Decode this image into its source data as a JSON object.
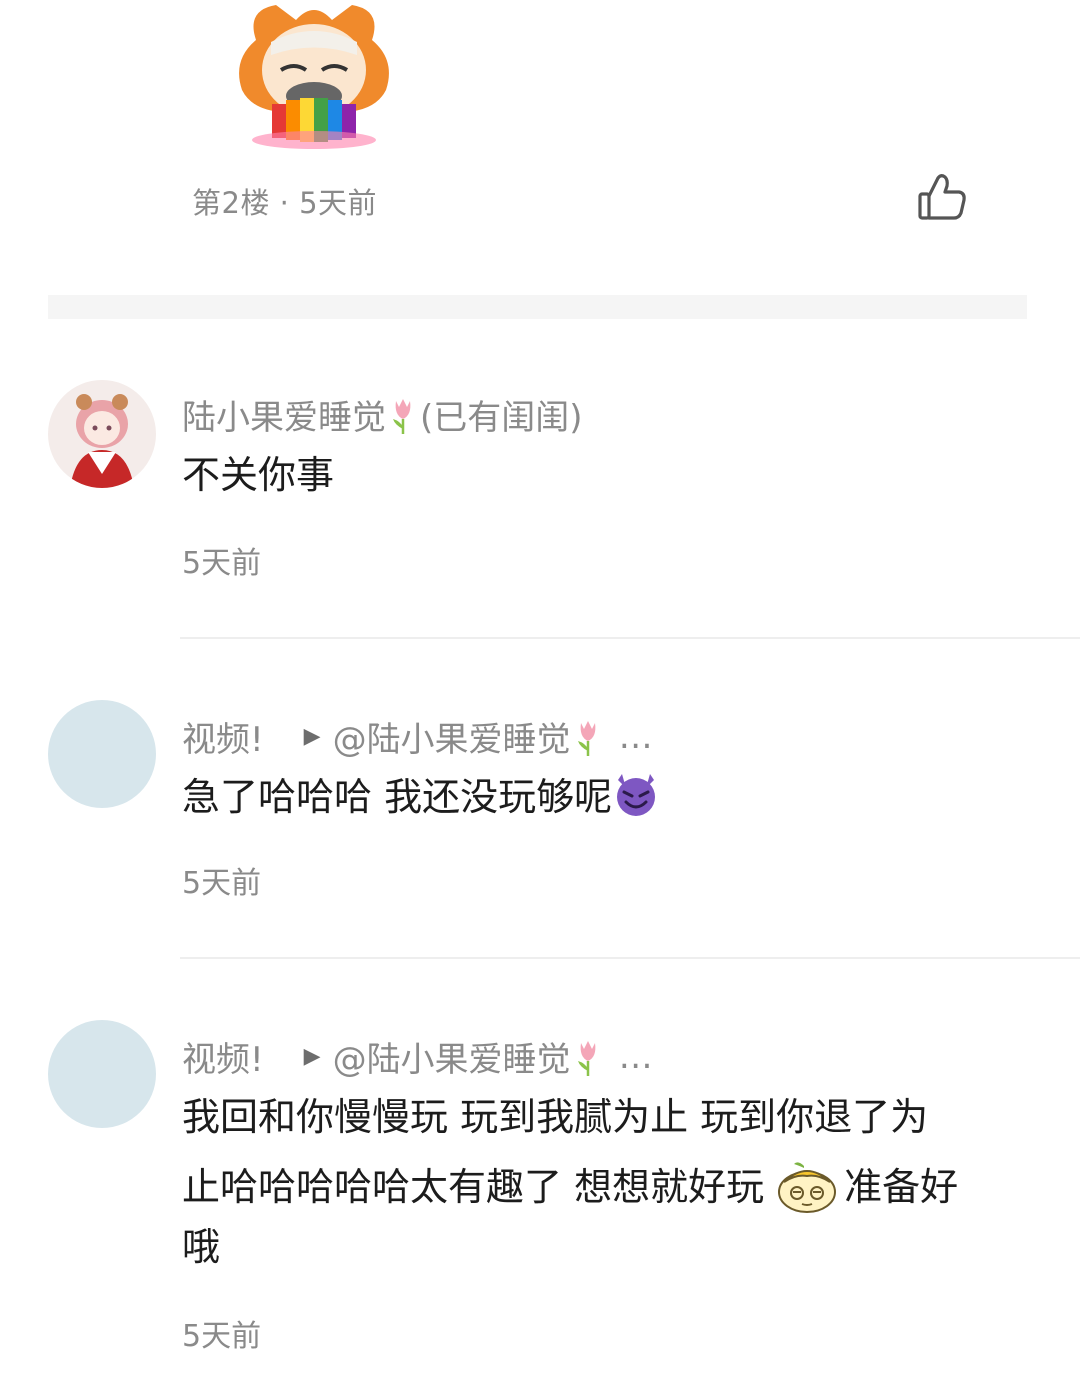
{
  "floor": {
    "meta": "第2楼 · 5天前",
    "sticker_icon": "rainbow-vomit-sticker",
    "like_icon": "thumbs-up-icon"
  },
  "comments": [
    {
      "avatar_icon": "anime-girl-avatar",
      "name": "陆小果爱睡觉",
      "name_suffix": "(已有闺闺)",
      "name_icon": "tulip-icon",
      "text": "不关你事",
      "time": "5天前"
    },
    {
      "avatar_icon": "blank-avatar",
      "name": "视频!",
      "reply_arrow_icon": "play-arrow-icon",
      "reply_to": "@陆小果爱睡觉",
      "reply_ellipsis": "…",
      "text": "急了哈哈哈 我还没玩够呢",
      "text_emoji": "smiling-devil-emoji",
      "time": "5天前"
    },
    {
      "avatar_icon": "blank-avatar",
      "name": "视频!",
      "reply_arrow_icon": "play-arrow-icon",
      "reply_to": "@陆小果爱睡觉",
      "reply_ellipsis": "…",
      "text_line1": "我回和你慢慢玩 玩到我腻为止 玩到你退了为",
      "text_line2a": "止哈哈哈哈哈太有趣了 想想就好玩",
      "text_emoji": "smug-face-sticker",
      "text_line2b": "准备好",
      "text_line3": "哦",
      "time": "5天前"
    }
  ],
  "colors": {
    "meta_text": "#8a8a8a",
    "body_text": "#1c1c1c",
    "plain_avatar": "#d7e6ec",
    "divider": "#eeeeee"
  }
}
